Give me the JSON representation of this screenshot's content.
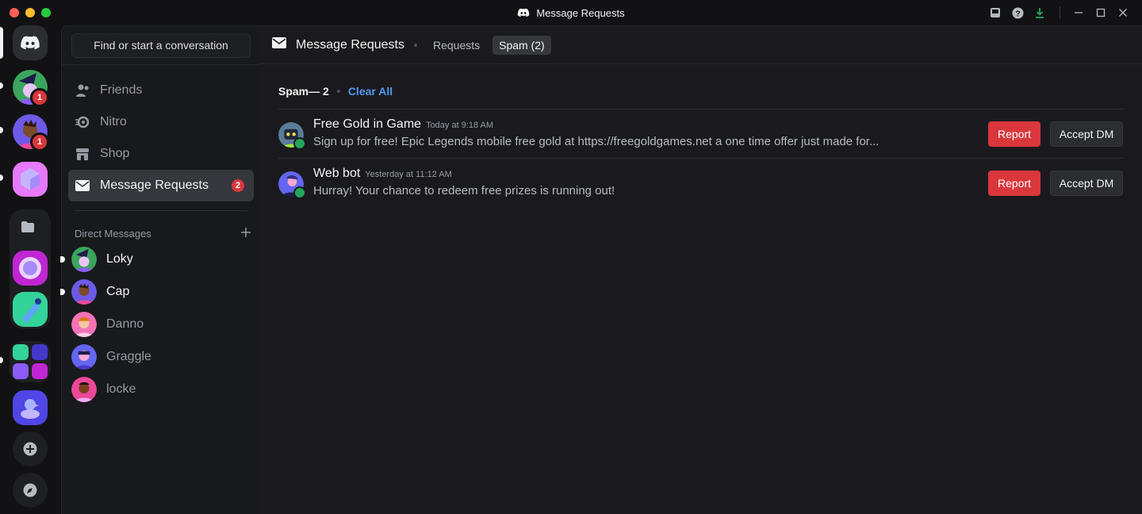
{
  "window": {
    "title": "Message Requests"
  },
  "rail": {
    "servers": [
      {
        "name": "home",
        "badge": ""
      },
      {
        "name": "loky",
        "badge": "1"
      },
      {
        "name": "cap",
        "badge": "1"
      }
    ]
  },
  "dm_column": {
    "search_label": "Find or start a conversation",
    "nav": [
      {
        "label": "Friends",
        "icon": "friends-icon"
      },
      {
        "label": "Nitro",
        "icon": "nitro-icon"
      },
      {
        "label": "Shop",
        "icon": "shop-icon"
      },
      {
        "label": "Message Requests",
        "icon": "mail-icon",
        "badge": "2"
      }
    ],
    "dm_header": "Direct Messages",
    "dms": [
      {
        "name": "Loky",
        "unread": true
      },
      {
        "name": "Cap",
        "unread": true
      },
      {
        "name": "Danno",
        "unread": false
      },
      {
        "name": "Graggle",
        "unread": false
      },
      {
        "name": "locke",
        "unread": false
      }
    ]
  },
  "main": {
    "title": "Message Requests",
    "tabs": [
      {
        "label": "Requests",
        "selected": false
      },
      {
        "label": "Spam (2)",
        "selected": true
      }
    ],
    "spam_title": "Spam— 2",
    "clear_all": "Clear All",
    "requests": [
      {
        "name": "Free Gold in Game",
        "time": "Today at 9:18 AM",
        "message": "Sign up for free! Epic Legends mobile free gold at https://freegoldgames.net a one time offer just made for...",
        "report": "Report",
        "accept": "Accept DM"
      },
      {
        "name": "Web bot",
        "time": "Yesterday at 11:12 AM",
        "message": "Hurray! Your chance to redeem free prizes is running out!",
        "report": "Report",
        "accept": "Accept DM"
      }
    ]
  },
  "colors": {
    "accent": "#5197ed",
    "danger": "#da373c",
    "online": "#23a55a"
  }
}
